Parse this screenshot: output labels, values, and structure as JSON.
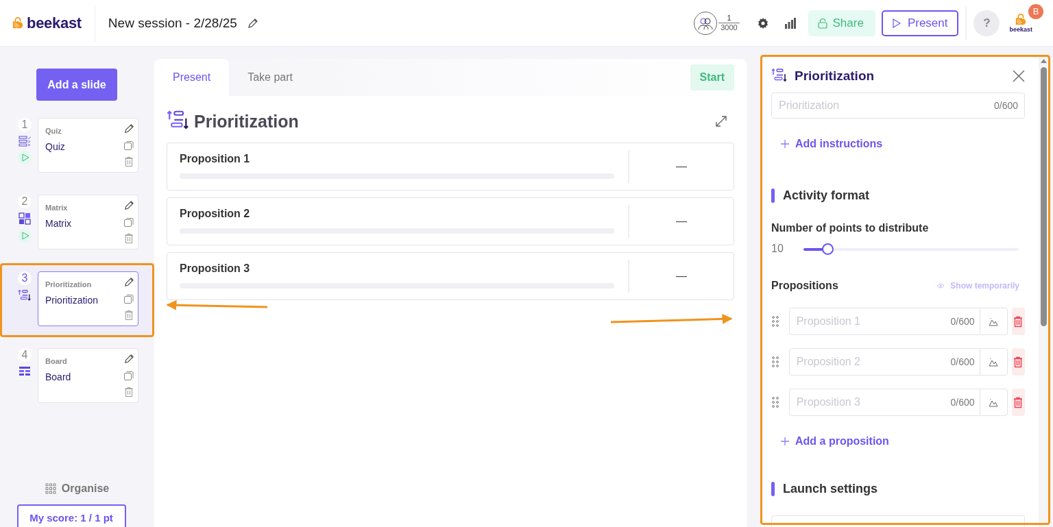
{
  "header": {
    "logo": "beekast",
    "session_title": "New session - 2/28/25",
    "participants": {
      "count": "1",
      "max": "3000"
    },
    "share": "Share",
    "present": "Present",
    "help": "?",
    "avatar_letter": "B",
    "account_logo": "beekast"
  },
  "sidebar": {
    "add_button": "Add a slide",
    "slides": [
      {
        "number": "1",
        "kind": "quiz",
        "type_label": "Quiz",
        "title": "Quiz",
        "played": true,
        "selected": false
      },
      {
        "number": "2",
        "kind": "matrix",
        "type_label": "Matrix",
        "title": "Matrix",
        "played": true,
        "selected": false
      },
      {
        "number": "3",
        "kind": "prioritization",
        "type_label": "Prioritization",
        "title": "Prioritization",
        "played": false,
        "selected": true
      },
      {
        "number": "4",
        "kind": "board",
        "type_label": "Board",
        "title": "Board",
        "played": false,
        "selected": false
      }
    ],
    "organise": "Organise",
    "score": "My score: 1 / 1 pt"
  },
  "stage": {
    "tabs": [
      {
        "label": "Present",
        "selected": true
      },
      {
        "label": "Take part",
        "selected": false
      }
    ],
    "start": "Start",
    "title": "Prioritization",
    "propositions": [
      {
        "label": "Proposition 1",
        "level": 0,
        "result": "—"
      },
      {
        "label": "Proposition 2",
        "level": 0,
        "result": "—"
      },
      {
        "label": "Proposition 3",
        "level": 0,
        "result": "—"
      }
    ]
  },
  "settings": {
    "title": "Prioritization",
    "title_field": {
      "placeholder": "Prioritization",
      "counter": "0/600"
    },
    "add_instructions": "Add instructions",
    "activity_format": "Activity format",
    "points_label": "Number of points to distribute",
    "points_value": "10",
    "points_slider": {
      "level": 0.11
    },
    "propositions_heading": "Propositions",
    "show_temporarily": "Show temporarily",
    "proposition_fields": [
      {
        "placeholder": "Proposition 1",
        "counter": "0/600"
      },
      {
        "placeholder": "Proposition 2",
        "counter": "0/600"
      },
      {
        "placeholder": "Proposition 3",
        "counter": "0/600"
      }
    ],
    "add_proposition": "Add a proposition",
    "launch_settings": "Launch settings"
  }
}
